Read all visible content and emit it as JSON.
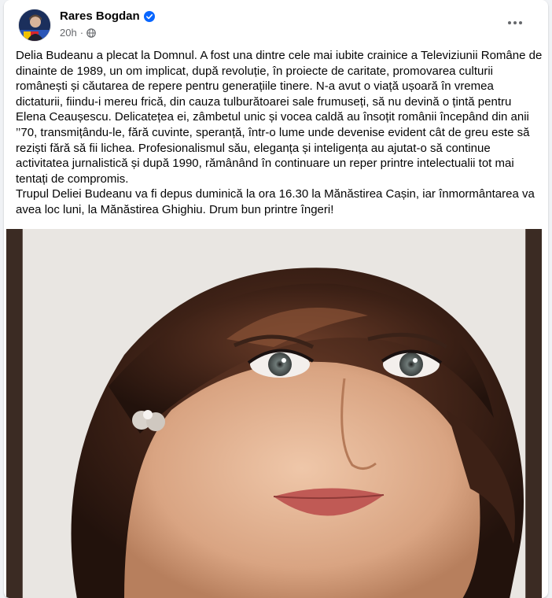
{
  "post": {
    "author": "Rares Bogdan",
    "time": "20h",
    "privacy_icon": "globe-icon",
    "verified_icon": "verified-badge-icon",
    "more_icon": "more-horizontal-icon",
    "body": "Delia Budeanu a plecat la Domnul. A fost una dintre cele mai iubite crainice a Televiziunii Române de dinainte de 1989, un om implicat, după revoluție, în proiecte de caritate, promovarea culturii românești și căutarea de repere pentru generațiile tinere. N-a avut o viață ușoară în vremea dictaturii, fiindu-i mereu frică, din cauza tulburătoarei sale frumuseți, să nu devină o țintă pentru Elena Ceaușescu. Delicatețea ei, zâmbetul unic și vocea caldă au însoțit românii începând din anii ’’70, transmițându-le, fără cuvinte, speranță, într-o lume unde devenise evident cât de greu este să reziști fără să fii lichea. Profesionalismul său, eleganța și inteligența au ajutat-o să continue activitatea jurnalistică și după 1990, rămânând în continuare un reper printre intelectualii tot mai tentați de compromis.\nTrupul Deliei Budeanu va fi depus duminică la ora 16.30 la Mănăstirea Cașin, iar înmormântarea va avea loc luni, la Mănăstirea Ghighiu. Drum bun printre îngeri!"
  },
  "colors": {
    "background": "#f0f2f5",
    "card": "#ffffff",
    "text": "#050505",
    "secondary_text": "#65676b",
    "verified": "#0866ff"
  }
}
